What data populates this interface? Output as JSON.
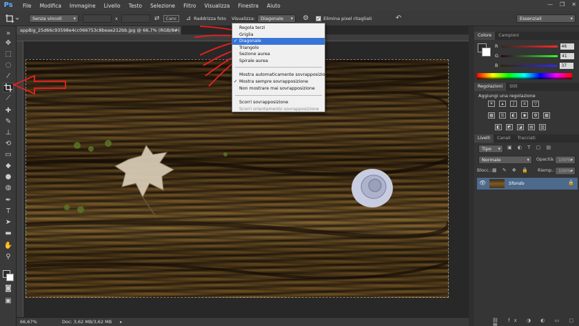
{
  "menu": [
    "File",
    "Modifica",
    "Immagine",
    "Livello",
    "Testo",
    "Selezione",
    "Filtro",
    "Visualizza",
    "Finestra",
    "Aiuto"
  ],
  "app_logo": "Ps",
  "window_controls": [
    "—",
    "❐",
    "✕"
  ],
  "options": {
    "constraint_select": "Senza vincoli",
    "x_separator": "x",
    "straighten_label": "Raddrizza foto",
    "view_label": "Visualizza:",
    "view_select": "Diagonale",
    "delete_cropped_label": "Elimina pixel ritagliati",
    "workspace_select": "Essenziali"
  },
  "document": {
    "tab_title": "appBig_25d66c93598e4cc066753c8beae212bb.jpg @ 66,7% (RGB/8#)",
    "zoom": "66,67%",
    "doc_size": "Doc: 3,62 MB/3,62 MB"
  },
  "dropdown": {
    "group1": [
      "Regola terzi",
      "Griglia",
      "Diagonale",
      "Triangolo",
      "Sezione aurea",
      "Spirale aurea"
    ],
    "selected": "Diagonale",
    "group2": [
      "Mostra automaticamente sovrapposizione",
      "Mostra sempre sovrapposizione",
      "Non mostrare mai sovrapposizione"
    ],
    "group2_checked": "Mostra sempre sovrapposizione",
    "group3": [
      "Scorri sovrapposizione",
      "Scorri orientamento sovrapposizione"
    ]
  },
  "color_panel": {
    "tabs": [
      "Colore",
      "Campioni"
    ],
    "channels": [
      {
        "label": "R",
        "value": "46",
        "color": "#d03030"
      },
      {
        "label": "G",
        "value": "41",
        "color": "#30b030"
      },
      {
        "label": "B",
        "value": "37",
        "color": "#3050d0"
      }
    ]
  },
  "adjustments_panel": {
    "tabs": [
      "Regolazioni",
      "Stili"
    ],
    "heading": "Aggiungi una regolazione"
  },
  "layers_panel": {
    "tabs": [
      "Livelli",
      "Canali",
      "Tracciati"
    ],
    "kind_filter": "Tipo",
    "blend_mode": "Normale",
    "opacity_label": "Opacità:",
    "opacity_value": "100%",
    "lock_label": "Blocc.:",
    "fill_label": "Riemp.:",
    "fill_value": "100%",
    "layer_name": "Sfondo"
  },
  "colors": {
    "accent_selection": "#3874d8",
    "annotation_red": "#e02020",
    "layer_selected": "#4d6a8d"
  }
}
